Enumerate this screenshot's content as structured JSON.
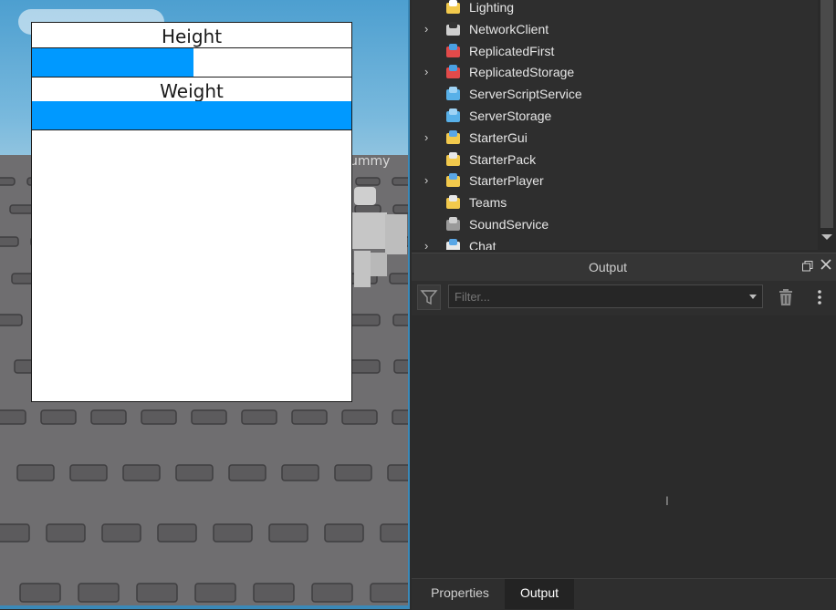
{
  "gui": {
    "stats": [
      {
        "label": "Height",
        "fill_fraction": 0.505
      },
      {
        "label": "Weight",
        "fill_fraction": 1.0
      }
    ],
    "fill_color": "#0099ff"
  },
  "viewport": {
    "dummy_label": "ummy"
  },
  "explorer": {
    "items": [
      {
        "label": "Lighting",
        "expandable": false,
        "icon": "lightbulb-icon"
      },
      {
        "label": "NetworkClient",
        "expandable": true,
        "icon": "network-client-icon"
      },
      {
        "label": "ReplicatedFirst",
        "expandable": false,
        "icon": "replicated-first-icon"
      },
      {
        "label": "ReplicatedStorage",
        "expandable": true,
        "icon": "replicated-storage-icon"
      },
      {
        "label": "ServerScriptService",
        "expandable": false,
        "icon": "server-script-service-icon"
      },
      {
        "label": "ServerStorage",
        "expandable": false,
        "icon": "server-storage-icon"
      },
      {
        "label": "StarterGui",
        "expandable": true,
        "icon": "starter-gui-icon"
      },
      {
        "label": "StarterPack",
        "expandable": false,
        "icon": "starter-pack-icon"
      },
      {
        "label": "StarterPlayer",
        "expandable": true,
        "icon": "starter-player-icon"
      },
      {
        "label": "Teams",
        "expandable": false,
        "icon": "teams-icon"
      },
      {
        "label": "SoundService",
        "expandable": false,
        "icon": "sound-service-icon"
      },
      {
        "label": "Chat",
        "expandable": true,
        "icon": "chat-icon"
      }
    ]
  },
  "output": {
    "title": "Output",
    "filter_placeholder": "Filter..."
  },
  "tabs": {
    "properties": "Properties",
    "output": "Output"
  }
}
